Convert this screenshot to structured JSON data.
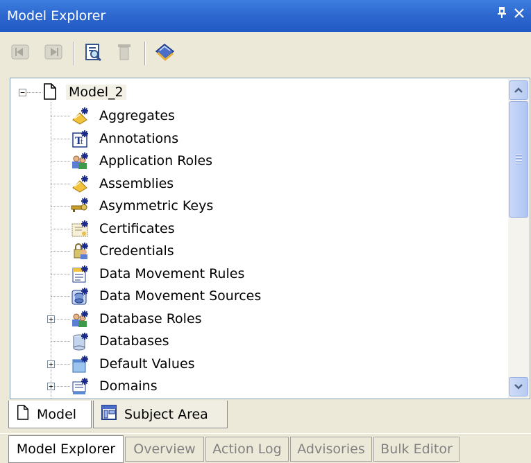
{
  "window": {
    "title": "Model Explorer",
    "pin_glyph": "I",
    "close_glyph": "×"
  },
  "toolbar": {
    "buttons": [
      {
        "name": "back-icon",
        "enabled": false
      },
      {
        "name": "forward-icon",
        "enabled": false
      },
      {
        "name": "find-icon",
        "enabled": true
      },
      {
        "name": "delete-icon",
        "enabled": false
      },
      {
        "name": "book-icon",
        "enabled": true
      }
    ]
  },
  "tree": {
    "root": {
      "label": "Model_2",
      "expanded": true
    },
    "items": [
      {
        "label": "Aggregates",
        "icon": "aggregates-icon",
        "expandable": false
      },
      {
        "label": "Annotations",
        "icon": "annotations-icon",
        "expandable": false
      },
      {
        "label": "Application Roles",
        "icon": "application-roles-icon",
        "expandable": false
      },
      {
        "label": "Assemblies",
        "icon": "assemblies-icon",
        "expandable": false
      },
      {
        "label": "Asymmetric Keys",
        "icon": "asymmetric-keys-icon",
        "expandable": false
      },
      {
        "label": "Certificates",
        "icon": "certificates-icon",
        "expandable": false
      },
      {
        "label": "Credentials",
        "icon": "credentials-icon",
        "expandable": false
      },
      {
        "label": "Data Movement Rules",
        "icon": "data-movement-rules-icon",
        "expandable": false
      },
      {
        "label": "Data Movement Sources",
        "icon": "data-movement-sources-icon",
        "expandable": false
      },
      {
        "label": "Database Roles",
        "icon": "database-roles-icon",
        "expandable": true
      },
      {
        "label": "Databases",
        "icon": "databases-icon",
        "expandable": false
      },
      {
        "label": "Default Values",
        "icon": "default-values-icon",
        "expandable": true
      },
      {
        "label": "Domains",
        "icon": "domains-icon",
        "expandable": true
      }
    ]
  },
  "view_tabs": [
    {
      "label": "Model",
      "active": true
    },
    {
      "label": "Subject Area",
      "active": false
    }
  ],
  "panel_tabs": [
    {
      "label": "Model Explorer",
      "active": true
    },
    {
      "label": "Overview",
      "active": false
    },
    {
      "label": "Action Log",
      "active": false
    },
    {
      "label": "Advisories",
      "active": false
    },
    {
      "label": "Bulk Editor",
      "active": false
    }
  ],
  "colors": {
    "title_bar": "#2e69cf",
    "selection_bg": "#f3f1e5",
    "panel_bg": "#ece9d8"
  }
}
